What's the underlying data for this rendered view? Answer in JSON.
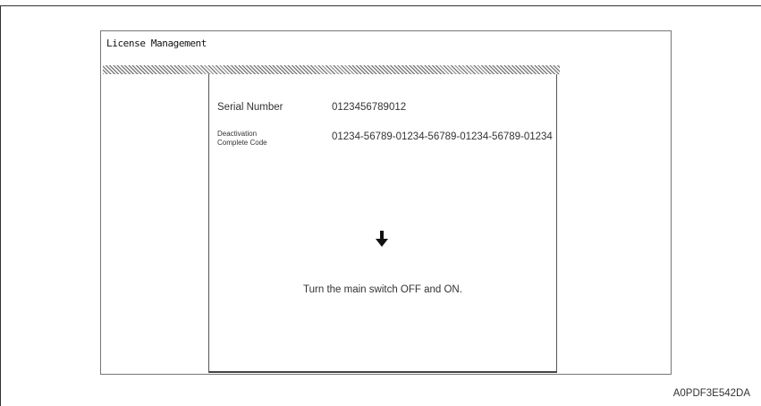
{
  "screen": {
    "title": "License Management"
  },
  "dialog": {
    "serial_number_label": "Serial Number",
    "serial_number_value": "0123456789012",
    "deactivation_label_line1": "Deactivation",
    "deactivation_label_line2": "Complete Code",
    "deactivation_code_value": "01234-56789-01234-56789-01234-56789-01234",
    "arrow_icon": "arrow-down-icon",
    "instruction": "Turn the main switch OFF and ON."
  },
  "figure": {
    "code": "A0PDF3E542DA"
  }
}
